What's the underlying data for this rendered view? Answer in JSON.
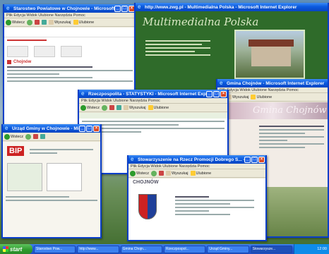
{
  "windows": {
    "w1": {
      "title": "Starostwo Powiatowe w Chojnowie - Microsoft Internet Explorer",
      "menu": "Plik  Edycja  Widok  Ulubione  Narzędzia  Pomoc",
      "toolbar": {
        "back": "Wstecz",
        "search": "Wyszukaj",
        "favorites": "Ulubione"
      },
      "heading": "Chojnów"
    },
    "w2": {
      "title": "http://www.zwg.pl - Multimedialna Polska - Microsoft Internet Explorer",
      "banner": "Multimedialna Polska"
    },
    "w3": {
      "title": "Gmina Chojnów - Microsoft Internet Explorer",
      "menu": "Plik  Edycja  Widok  Ulubione  Narzędzia  Pomoc",
      "toolbar": {
        "search": "Wyszukaj",
        "favorites": "Ulubione"
      },
      "banner": "Gmina Chojnów"
    },
    "w4": {
      "title": "Rzeczpospolita - STATYSTYKI - Microsoft Internet Explorer",
      "menu": "Plik  Edycja  Widok  Ulubione  Narzędzia  Pomoc",
      "toolbar": {
        "back": "Wstecz",
        "search": "Wyszukaj",
        "favorites": "Ulubione"
      }
    },
    "w5": {
      "title": "Urząd Gminy w Chojnowie - Microsoft Internet Explorer",
      "toolbar": {
        "back": "Wstecz"
      },
      "logo_text": "BIP"
    },
    "w6": {
      "title": "Stowarzyszenie na Rzecz Promocji Dobrego S... - Microsoft Internet Explorer",
      "menu": "Plik  Edycja  Widok  Ulubione  Narzędzia  Pomoc",
      "toolbar": {
        "back": "Wstecz",
        "search": "Wyszukaj",
        "favorites": "Ulubione"
      },
      "heading": "CHOJNÓW"
    }
  },
  "taskbar": {
    "start": "start",
    "tasks": [
      "Starostwo Pow...",
      "http://www...",
      "Gmina Chojn...",
      "Rzeczpospol...",
      "Urząd Gminy...",
      "Stowarzysze..."
    ],
    "clock": "12:00"
  },
  "colors": {
    "title_blue": "#0a5adf",
    "green_site": "#2f6b2a",
    "red_accent": "#c33"
  }
}
